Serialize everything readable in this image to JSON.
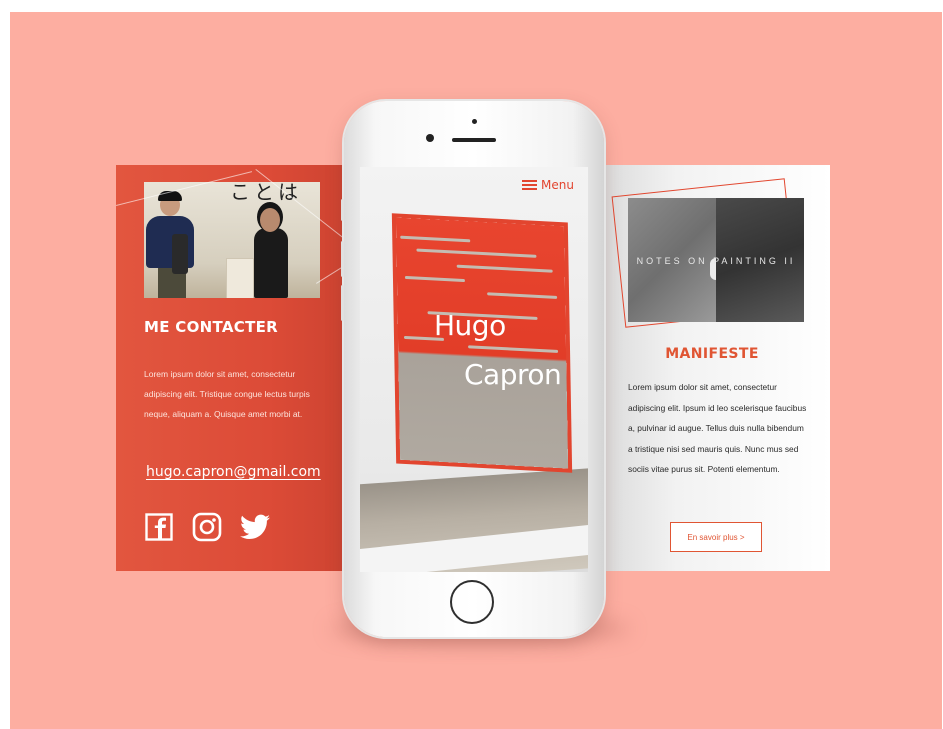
{
  "colors": {
    "background": "#fdaea1",
    "accent": "#e2452f",
    "left_panel": "#dc4b37",
    "text_dark": "#2a2a2a"
  },
  "contact_panel": {
    "title": "ME CONTACTER",
    "body": "Lorem ipsum dolor sit amet, consectetur adipiscing elit. Tristique congue lectus turpis neque, aliquam a. Quisque amet morbi at.",
    "email": "hugo.capron@gmail.com",
    "photo_sign": "ことは",
    "social_icons": [
      "facebook-icon",
      "instagram-icon",
      "twitter-icon"
    ]
  },
  "phone": {
    "menu_label": "Menu",
    "menu_icon": "hamburger-icon",
    "hero_first": "Hugo",
    "hero_last": "Capron"
  },
  "manifest_panel": {
    "painting_caption": "NOTES ON PAINTING II",
    "title": "MANIFESTE",
    "body": "Lorem ipsum dolor sit amet, consectetur adipiscing elit. Ipsum id leo scelerisque faucibus a, pulvinar id augue. Tellus duis nulla bibendum a tristique nisi sed mauris quis. Nunc mus sed sociis vitae purus sit. Potenti elementum.",
    "button_label": "En savoir plus >"
  }
}
